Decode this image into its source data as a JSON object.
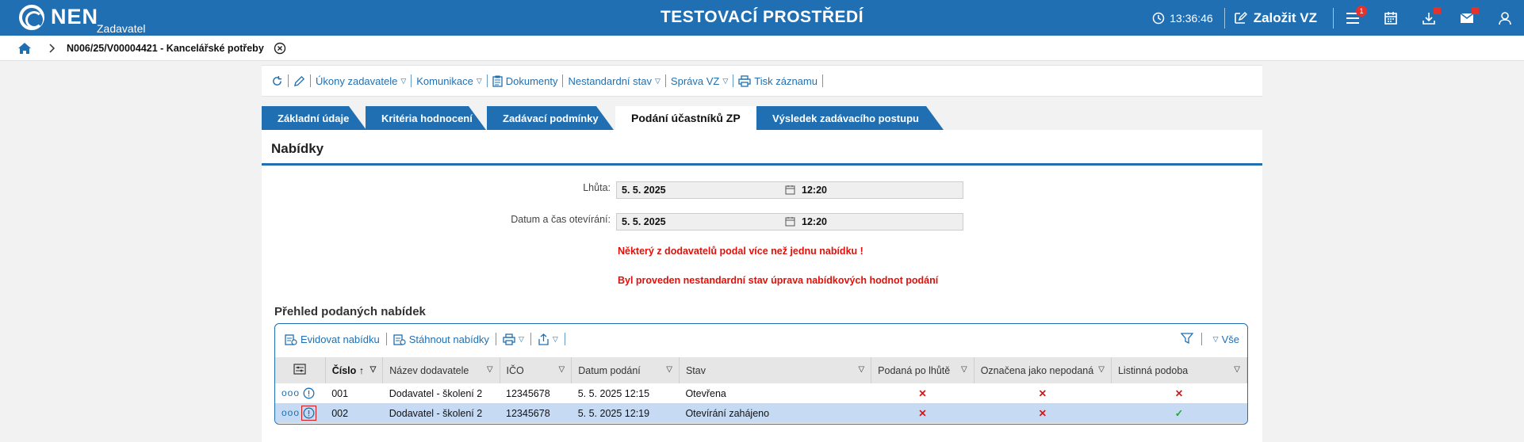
{
  "header": {
    "brand": "NEN",
    "brand_sub": "Zadavatel",
    "env_title": "TESTOVACÍ PROSTŘEDÍ",
    "time": "13:36:46",
    "create_label": "Založit VZ",
    "menu_badge": "1"
  },
  "breadcrumb": {
    "title": "N006/25/V00004421 - Kancelářské potřeby"
  },
  "actions": {
    "ukony": "Úkony zadavatele",
    "komunikace": "Komunikace",
    "dokumenty": "Dokumenty",
    "nestandardni": "Nestandardní stav",
    "sprava": "Správa VZ",
    "tisk": "Tisk záznamu"
  },
  "tabs": [
    {
      "label": "Základní údaje"
    },
    {
      "label": "Kritéria hodnocení"
    },
    {
      "label": "Zadávací podmínky"
    },
    {
      "label": "Podání účastníků ZP"
    },
    {
      "label": "Výsledek zadávacího postupu"
    }
  ],
  "panel": {
    "title": "Nabídky",
    "lhuta_label": "Lhůta:",
    "lhuta_date": "5. 5. 2025",
    "lhuta_time": "12:20",
    "otevirani_label": "Datum a čas otevírání:",
    "otevirani_date": "5. 5. 2025",
    "otevirani_time": "12:20",
    "warning1": "Některý z dodavatelů podal více než jednu nabídku !",
    "warning2": "Byl proveden nestandardní stav úprava nabídkových hodnot podání",
    "section_title": "Přehled podaných nabídek"
  },
  "grid": {
    "evidovat": "Evidovat nabídku",
    "stahnout": "Stáhnout nabídky",
    "filter_all": "Vše",
    "columns": {
      "cislo": "Číslo",
      "nazev": "Název dodavatele",
      "ico": "IČO",
      "datum": "Datum podání",
      "stav": "Stav",
      "po_lhute": "Podaná po lhůtě",
      "nepodana": "Označena jako nepodaná",
      "listinna": "Listinná podoba"
    },
    "rows": [
      {
        "cislo": "001",
        "nazev": "Dodavatel - školení 2",
        "ico": "12345678",
        "datum": "5. 5. 2025 12:15",
        "stav": "Otevřena"
      },
      {
        "cislo": "002",
        "nazev": "Dodavatel - školení 2",
        "ico": "12345678",
        "datum": "5. 5. 2025 12:19",
        "stav": "Otevírání zahájeno"
      }
    ]
  }
}
